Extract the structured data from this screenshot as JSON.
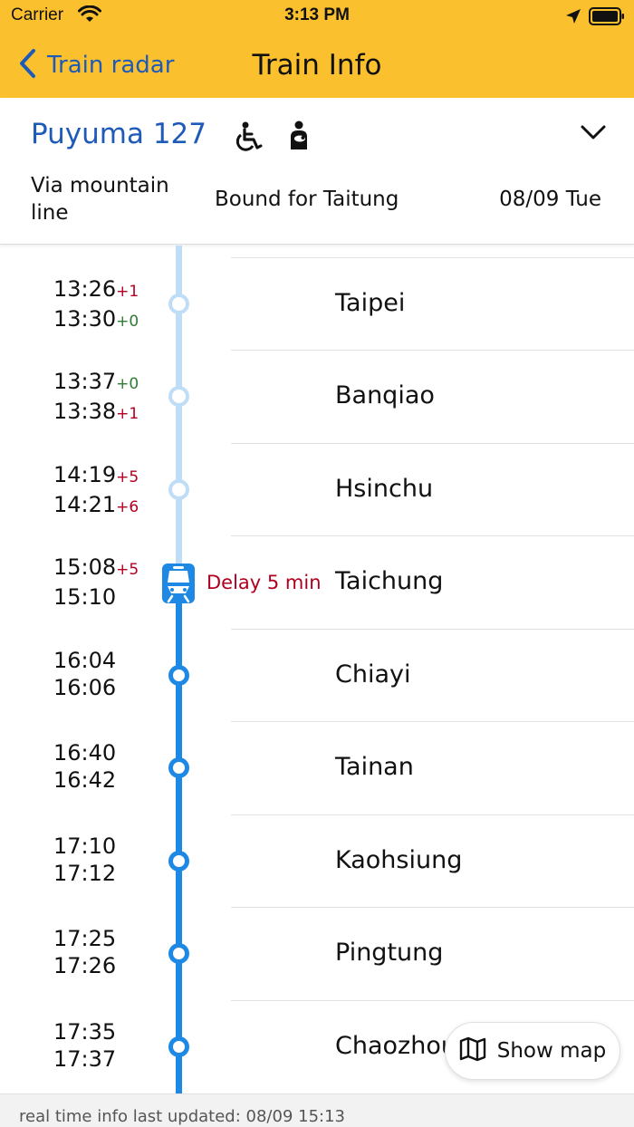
{
  "status_bar": {
    "carrier": "Carrier",
    "time": "3:13 PM"
  },
  "nav": {
    "back_label": "Train radar",
    "title": "Train Info"
  },
  "train": {
    "name": "Puyuma 127",
    "route": "Via mountain line",
    "bound_for": "Bound for Taitung",
    "date": "08/09 Tue",
    "amenities": [
      "wheelchair-icon",
      "nursing-icon"
    ]
  },
  "stops": [
    {
      "station": "Taipei",
      "arrive": "13:26",
      "arrive_delta": "+1",
      "depart": "13:30",
      "depart_delta": "+0"
    },
    {
      "station": "Banqiao",
      "arrive": "13:37",
      "arrive_delta": "+0",
      "depart": "13:38",
      "depart_delta": "+1"
    },
    {
      "station": "Hsinchu",
      "arrive": "14:19",
      "arrive_delta": "+5",
      "depart": "14:21",
      "depart_delta": "+6"
    },
    {
      "station": "Taichung",
      "arrive": "15:08",
      "arrive_delta": "+5",
      "depart": "15:10",
      "depart_delta": "",
      "delay_label": "Delay 5 min"
    },
    {
      "station": "Chiayi",
      "arrive": "16:04",
      "arrive_delta": "",
      "depart": "16:06",
      "depart_delta": ""
    },
    {
      "station": "Tainan",
      "arrive": "16:40",
      "arrive_delta": "",
      "depart": "16:42",
      "depart_delta": ""
    },
    {
      "station": "Kaohsiung",
      "arrive": "17:10",
      "arrive_delta": "",
      "depart": "17:12",
      "depart_delta": ""
    },
    {
      "station": "Pingtung",
      "arrive": "17:25",
      "arrive_delta": "",
      "depart": "17:26",
      "depart_delta": ""
    },
    {
      "station": "Chaozhou",
      "arrive": "17:35",
      "arrive_delta": "",
      "depart": "17:37",
      "depart_delta": ""
    }
  ],
  "show_map": {
    "label": "Show map"
  },
  "footer": {
    "text": "real time info last updated: 08/09 15:13"
  },
  "colors": {
    "header_bg": "#FBC02D",
    "accent_blue": "#1E5BB8",
    "track_passed": "#BFDDF7",
    "track_upcoming": "#1E88E5",
    "delay_red": "#B00020",
    "ontime_green": "#2E7D32"
  }
}
